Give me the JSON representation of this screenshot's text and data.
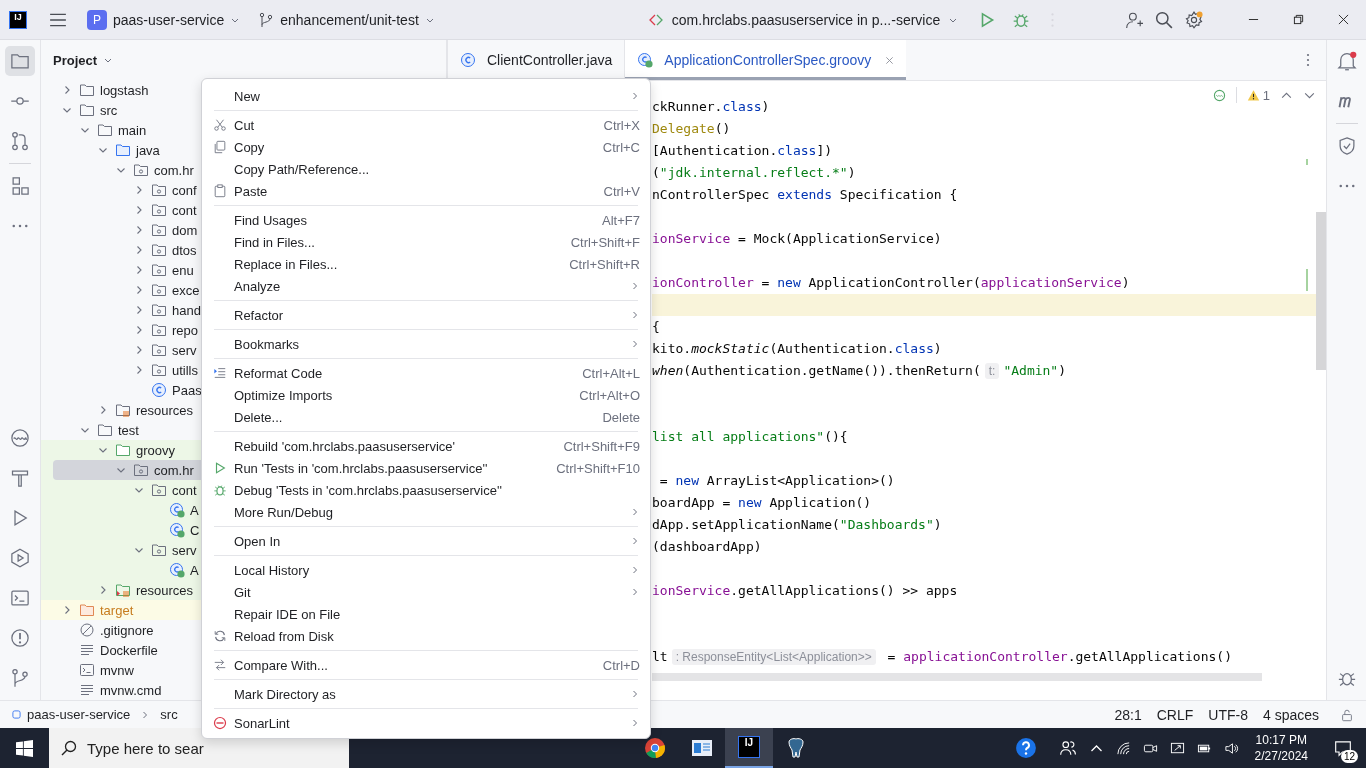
{
  "title_bar": {
    "logo": "IJ",
    "project_badge": "P",
    "project": "paas-user-service",
    "branch": "enhancement/unit-test",
    "run_config": "com.hrclabs.paasuserservice in p...-service"
  },
  "tool_window": {
    "title": "Project"
  },
  "tree": [
    {
      "label": "logstash",
      "kind": "folder",
      "expanded": false,
      "selected": false
    },
    {
      "label": "src",
      "kind": "folder",
      "expanded": true,
      "selected": false,
      "children": [
        {
          "label": "main",
          "kind": "folder",
          "expanded": true,
          "selected": false,
          "children": [
            {
              "label": "java",
              "kind": "source",
              "expanded": true,
              "selected": false,
              "children": [
                {
                  "label": "com.hr",
                  "kind": "package",
                  "expanded": true,
                  "selected": false,
                  "children": [
                    {
                      "label": "conf",
                      "kind": "package",
                      "expanded": false,
                      "selected": false
                    },
                    {
                      "label": "cont",
                      "kind": "package",
                      "expanded": false,
                      "selected": false
                    },
                    {
                      "label": "dom",
                      "kind": "package",
                      "expanded": false,
                      "selected": false
                    },
                    {
                      "label": "dtos",
                      "kind": "package",
                      "expanded": false,
                      "selected": false
                    },
                    {
                      "label": "enu",
                      "kind": "package",
                      "expanded": false,
                      "selected": false
                    },
                    {
                      "label": "exce",
                      "kind": "package",
                      "expanded": false,
                      "selected": false
                    },
                    {
                      "label": "hand",
                      "kind": "package",
                      "expanded": false,
                      "selected": false
                    },
                    {
                      "label": "repo",
                      "kind": "package",
                      "expanded": false,
                      "selected": false
                    },
                    {
                      "label": "serv",
                      "kind": "package",
                      "expanded": false,
                      "selected": false
                    },
                    {
                      "label": "utills",
                      "kind": "package",
                      "expanded": false,
                      "selected": false
                    },
                    {
                      "label": "Paas",
                      "kind": "class",
                      "selected": false
                    }
                  ]
                }
              ]
            },
            {
              "label": "resources",
              "kind": "resources",
              "expanded": false,
              "selected": false
            }
          ]
        },
        {
          "label": "test",
          "kind": "folder",
          "expanded": true,
          "selected": false,
          "children": [
            {
              "label": "groovy",
              "kind": "test",
              "expanded": true,
              "selected": false,
              "children": [
                {
                  "label": "com.hr",
                  "kind": "package",
                  "expanded": true,
                  "selected": true,
                  "children": [
                    {
                      "label": "cont",
                      "kind": "package",
                      "expanded": true,
                      "selected": false,
                      "children": [
                        {
                          "label": "A",
                          "kind": "groovy",
                          "selected": false
                        },
                        {
                          "label": "C",
                          "kind": "groovy",
                          "selected": false
                        }
                      ]
                    },
                    {
                      "label": "serv",
                      "kind": "package",
                      "expanded": true,
                      "selected": false,
                      "children": [
                        {
                          "label": "A",
                          "kind": "groovy",
                          "selected": false
                        }
                      ]
                    }
                  ]
                }
              ]
            },
            {
              "label": "resources",
              "kind": "testresources",
              "expanded": false,
              "selected": false
            }
          ]
        }
      ]
    },
    {
      "label": "target",
      "kind": "excluded",
      "expanded": false,
      "selected": false
    },
    {
      "label": ".gitignore",
      "kind": "ignore",
      "selected": false
    },
    {
      "label": "Dockerfile",
      "kind": "text",
      "selected": false
    },
    {
      "label": "mvnw",
      "kind": "script",
      "selected": false
    },
    {
      "label": "mvnw.cmd",
      "kind": "text",
      "selected": false
    }
  ],
  "editor": {
    "tabs": [
      {
        "label": "ClientController.java",
        "kind": "class",
        "selected": false
      },
      {
        "label": "ApplicationControllerSpec.groovy",
        "kind": "groovy",
        "selected": true
      }
    ],
    "warnings": "1",
    "lines": [
      {
        "current": false,
        "tokens": [
          {
            "text": "ckRunner.",
            "kind": "plain"
          },
          {
            "text": "class",
            "kind": "keyword"
          },
          {
            "text": ")",
            "kind": "plain"
          }
        ]
      },
      {
        "current": false,
        "tokens": [
          {
            "text": "Delegate",
            "kind": "annotation"
          },
          {
            "text": "()",
            "kind": "plain"
          }
        ]
      },
      {
        "current": false,
        "tokens": [
          {
            "text": "[Authentication.",
            "kind": "plain"
          },
          {
            "text": "class",
            "kind": "keyword"
          },
          {
            "text": "])",
            "kind": "plain"
          }
        ]
      },
      {
        "current": false,
        "tokens": [
          {
            "text": "(",
            "kind": "plain"
          },
          {
            "text": "\"jdk.internal.reflect.*\"",
            "kind": "string"
          },
          {
            "text": ")",
            "kind": "plain"
          }
        ]
      },
      {
        "current": false,
        "tokens": [
          {
            "text": "nControllerSpec ",
            "kind": "plain"
          },
          {
            "text": "extends",
            "kind": "keyword"
          },
          {
            "text": " Specification {",
            "kind": "plain"
          }
        ]
      },
      {
        "current": false
      },
      {
        "current": false,
        "tokens": [
          {
            "text": "ionService",
            "kind": "field"
          },
          {
            "text": " = Mock(ApplicationService)",
            "kind": "plain"
          }
        ]
      },
      {
        "current": false
      },
      {
        "current": false,
        "tokens": [
          {
            "text": "ionController",
            "kind": "field"
          },
          {
            "text": " = ",
            "kind": "plain"
          },
          {
            "text": "new",
            "kind": "keyword"
          },
          {
            "text": " ApplicationController(",
            "kind": "plain"
          },
          {
            "text": "applicationService",
            "kind": "field"
          },
          {
            "text": ")",
            "kind": "plain"
          }
        ]
      },
      {
        "current": true
      },
      {
        "current": false,
        "tokens": [
          {
            "text": "{",
            "kind": "plain"
          }
        ]
      },
      {
        "current": false,
        "tokens": [
          {
            "text": "kito.",
            "kind": "plain"
          },
          {
            "text": "mockStatic",
            "kind": "italic"
          },
          {
            "text": "(Authentication.",
            "kind": "plain"
          },
          {
            "text": "class",
            "kind": "keyword"
          },
          {
            "text": ")",
            "kind": "plain"
          }
        ]
      },
      {
        "current": false,
        "tokens": [
          {
            "text": "when",
            "kind": "italic"
          },
          {
            "text": "(Authentication.getName()).thenReturn(",
            "kind": "plain"
          },
          {
            "text": "t:",
            "kind": "hint"
          },
          {
            "text": "\"Admin\"",
            "kind": "string"
          },
          {
            "text": ")",
            "kind": "plain"
          }
        ]
      },
      {
        "current": false
      },
      {
        "current": false
      },
      {
        "current": false,
        "tokens": [
          {
            "text": "list all applications\"",
            "kind": "string"
          },
          {
            "text": "(){",
            "kind": "plain"
          }
        ]
      },
      {
        "current": false
      },
      {
        "current": false,
        "tokens": [
          {
            "text": " = ",
            "kind": "plain"
          },
          {
            "text": "new",
            "kind": "keyword"
          },
          {
            "text": " ArrayList<Application>()",
            "kind": "plain"
          }
        ]
      },
      {
        "current": false,
        "tokens": [
          {
            "text": "boardApp = ",
            "kind": "plain"
          },
          {
            "text": "new",
            "kind": "keyword"
          },
          {
            "text": " Application()",
            "kind": "plain"
          }
        ]
      },
      {
        "current": false,
        "tokens": [
          {
            "text": "dApp.setApplicationName(",
            "kind": "plain"
          },
          {
            "text": "\"Dashboards\"",
            "kind": "string"
          },
          {
            "text": ")",
            "kind": "plain"
          }
        ]
      },
      {
        "current": false,
        "tokens": [
          {
            "text": "(dashboardApp)",
            "kind": "plain"
          }
        ]
      },
      {
        "current": false
      },
      {
        "current": false,
        "tokens": [
          {
            "text": "ionService",
            "kind": "field"
          },
          {
            "text": ".getAllApplications() >> apps",
            "kind": "plain"
          }
        ]
      },
      {
        "current": false
      },
      {
        "current": false
      },
      {
        "current": false,
        "tokens": [
          {
            "text": "lt",
            "kind": "plain"
          },
          {
            "text": ": ResponseEntity<List<Application>>",
            "kind": "hint"
          },
          {
            "text": " = ",
            "kind": "plain"
          },
          {
            "text": "applicationController",
            "kind": "field"
          },
          {
            "text": ".getAllApplications()",
            "kind": "plain"
          }
        ]
      }
    ]
  },
  "context_menu": [
    {
      "kind": "plain",
      "label": "New",
      "submenu": true
    },
    {
      "kind": "separator"
    },
    {
      "kind": "cut",
      "label": "Cut",
      "shortcut": "Ctrl+X"
    },
    {
      "kind": "copy",
      "label": "Copy",
      "shortcut": "Ctrl+C"
    },
    {
      "kind": "plain",
      "label": "Copy Path/Reference..."
    },
    {
      "kind": "paste",
      "label": "Paste",
      "shortcut": "Ctrl+V"
    },
    {
      "kind": "separator"
    },
    {
      "kind": "plain",
      "label": "Find Usages",
      "shortcut": "Alt+F7"
    },
    {
      "kind": "plain",
      "label": "Find in Files...",
      "shortcut": "Ctrl+Shift+F"
    },
    {
      "kind": "plain",
      "label": "Replace in Files...",
      "shortcut": "Ctrl+Shift+R"
    },
    {
      "kind": "plain",
      "label": "Analyze",
      "submenu": true
    },
    {
      "kind": "separator"
    },
    {
      "kind": "plain",
      "label": "Refactor",
      "submenu": true
    },
    {
      "kind": "separator"
    },
    {
      "kind": "plain",
      "label": "Bookmarks",
      "submenu": true
    },
    {
      "kind": "separator"
    },
    {
      "kind": "reformat",
      "label": "Reformat Code",
      "shortcut": "Ctrl+Alt+L"
    },
    {
      "kind": "plain",
      "label": "Optimize Imports",
      "shortcut": "Ctrl+Alt+O"
    },
    {
      "kind": "plain",
      "label": "Delete...",
      "shortcut": "Delete"
    },
    {
      "kind": "separator"
    },
    {
      "kind": "plain",
      "label": "Rebuild 'com.hrclabs.paasuserservice'",
      "shortcut": "Ctrl+Shift+F9"
    },
    {
      "kind": "run",
      "label": "Run 'Tests in 'com.hrclabs.paasuserservice''",
      "shortcut": "Ctrl+Shift+F10"
    },
    {
      "kind": "debug",
      "label": "Debug 'Tests in 'com.hrclabs.paasuserservice''"
    },
    {
      "kind": "plain",
      "label": "More Run/Debug",
      "submenu": true
    },
    {
      "kind": "separator"
    },
    {
      "kind": "plain",
      "label": "Open In",
      "submenu": true
    },
    {
      "kind": "separator"
    },
    {
      "kind": "plain",
      "label": "Local History",
      "submenu": true
    },
    {
      "kind": "plain",
      "label": "Git",
      "submenu": true
    },
    {
      "kind": "plain",
      "label": "Repair IDE on File"
    },
    {
      "kind": "reload",
      "label": "Reload from Disk"
    },
    {
      "kind": "separator"
    },
    {
      "kind": "compare",
      "label": "Compare With...",
      "shortcut": "Ctrl+D"
    },
    {
      "kind": "separator"
    },
    {
      "kind": "plain",
      "label": "Mark Directory as",
      "submenu": true
    },
    {
      "kind": "separator"
    },
    {
      "kind": "sonarlint",
      "label": "SonarLint",
      "submenu": true
    }
  ],
  "status_bar": {
    "breadcrumbs": [
      "paas-user-service",
      "src"
    ],
    "position": "28:1",
    "line_ending": "CRLF",
    "encoding": "UTF-8",
    "indent": "4 spaces"
  },
  "taskbar": {
    "placeholder": "Type here to sear",
    "app_logo": "IJ",
    "time": "10:17 PM",
    "date": "2/27/2024",
    "notifications": "12"
  }
}
